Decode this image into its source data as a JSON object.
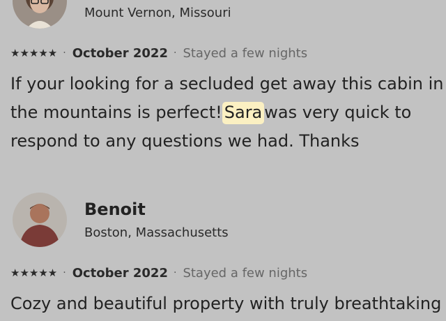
{
  "reviews": [
    {
      "location": "Mount Vernon, Missouri",
      "stars": "★★★★★",
      "date": "October 2022",
      "stay": "Stayed a few nights",
      "text_line1": "If your looking for a secluded get away this cabin in",
      "text_line2_before": "the mountains  is perfect!",
      "text_line2_highlight": "Sara",
      "text_line2_after": "was very quick to",
      "text_line3": "respond to any questions we had. Thanks"
    },
    {
      "name": "Benoit",
      "location": "Boston, Massachusetts",
      "stars": "★★★★★",
      "date": "October 2022",
      "stay": "Stayed a few nights",
      "text_line1": "Cozy and beautiful property with truly breathtaking"
    }
  ],
  "separator": "·"
}
